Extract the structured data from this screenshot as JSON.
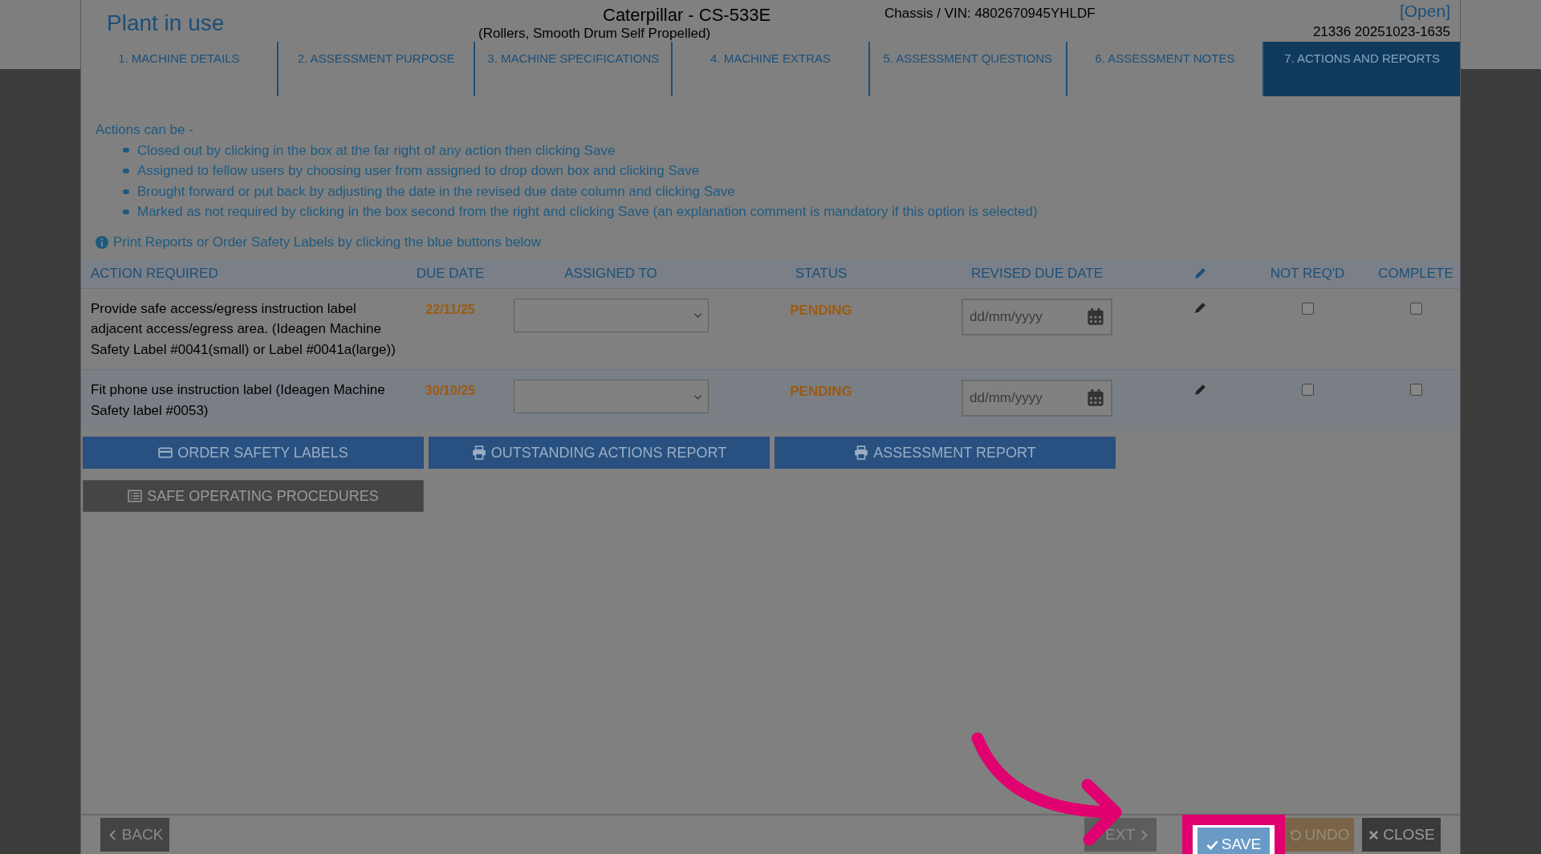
{
  "header": {
    "title": "Plant in use",
    "machine": "Caterpillar - CS-533E",
    "machine_type": "(Rollers, Smooth Drum Self Propelled)",
    "chassis": "Chassis / VIN: 4802670945YHLDF",
    "state": "[Open]",
    "reference": "21336 20251023-1635"
  },
  "tabs": [
    {
      "label": "1. MACHINE DETAILS",
      "selected": false
    },
    {
      "label": "2. ASSESSMENT PURPOSE",
      "selected": false
    },
    {
      "label": "3. MACHINE SPECIFICATIONS",
      "selected": false
    },
    {
      "label": "4. MACHINE EXTRAS",
      "selected": false
    },
    {
      "label": "5. ASSESSMENT QUESTIONS",
      "selected": false
    },
    {
      "label": "6. ASSESSMENT NOTES",
      "selected": false
    },
    {
      "label": "7. ACTIONS AND REPORTS",
      "selected": true
    }
  ],
  "instructions": {
    "intro": "Actions can be -",
    "bullets": [
      "Closed out by clicking in the box at the far right of any action then clicking Save",
      "Assigned to fellow users by choosing user from assigned to drop down box and clicking Save",
      "Brought forward or put back by adjusting the date in the revised due date column and clicking Save",
      "Marked as not required by clicking in the box second from the right and clicking Save (an explanation comment is mandatory if this option is selected)"
    ],
    "note": "Print Reports or Order Safety Labels by clicking the blue buttons below"
  },
  "table": {
    "columns": [
      {
        "kind": "text",
        "label": "ACTION REQUIRED"
      },
      {
        "kind": "text",
        "label": "DUE DATE"
      },
      {
        "kind": "text",
        "label": "ASSIGNED TO"
      },
      {
        "kind": "text",
        "label": "STATUS"
      },
      {
        "kind": "text",
        "label": "REVISED DUE DATE"
      },
      {
        "kind": "icon"
      },
      {
        "kind": "text",
        "label": "NOT REQ'D"
      },
      {
        "kind": "text",
        "label": "COMPLETE"
      }
    ],
    "rows": [
      {
        "action": "Provide safe access/egress instruction label adjacent access/egress area. (Ideagen Machine Safety Label #0041(small) or Label #0041a(large))",
        "due_date": "22/11/25",
        "status": "PENDING",
        "revised_due_date": {
          "placeholder": "dd/mm/yyyy"
        },
        "not_required": false,
        "complete": false
      },
      {
        "action": "Fit phone use instruction label (Ideagen Machine Safety label #0053)",
        "due_date": "30/10/25",
        "status": "PENDING",
        "revised_due_date": {
          "placeholder": "dd/mm/yyyy"
        },
        "not_required": false,
        "complete": false
      }
    ]
  },
  "report_buttons": [
    {
      "label": "ORDER SAFETY LABELS",
      "kind": "labels"
    },
    {
      "label": "OUTSTANDING ACTIONS REPORT",
      "kind": "report"
    },
    {
      "label": "ASSESSMENT REPORT",
      "kind": "report"
    },
    {
      "label": "SAFE OPERATING PROCEDURES",
      "kind": "procedures"
    }
  ],
  "footer": {
    "left": [
      {
        "label": "BACK",
        "kind": "back"
      }
    ],
    "right": [
      {
        "label": "EXT",
        "kind": "next",
        "highlighted": false
      },
      {
        "label": "SAVE",
        "kind": "save",
        "highlighted": true
      },
      {
        "label": "UNDO",
        "kind": "undo",
        "highlighted": false
      },
      {
        "label": "CLOSE",
        "kind": "close",
        "highlighted": false
      }
    ]
  }
}
